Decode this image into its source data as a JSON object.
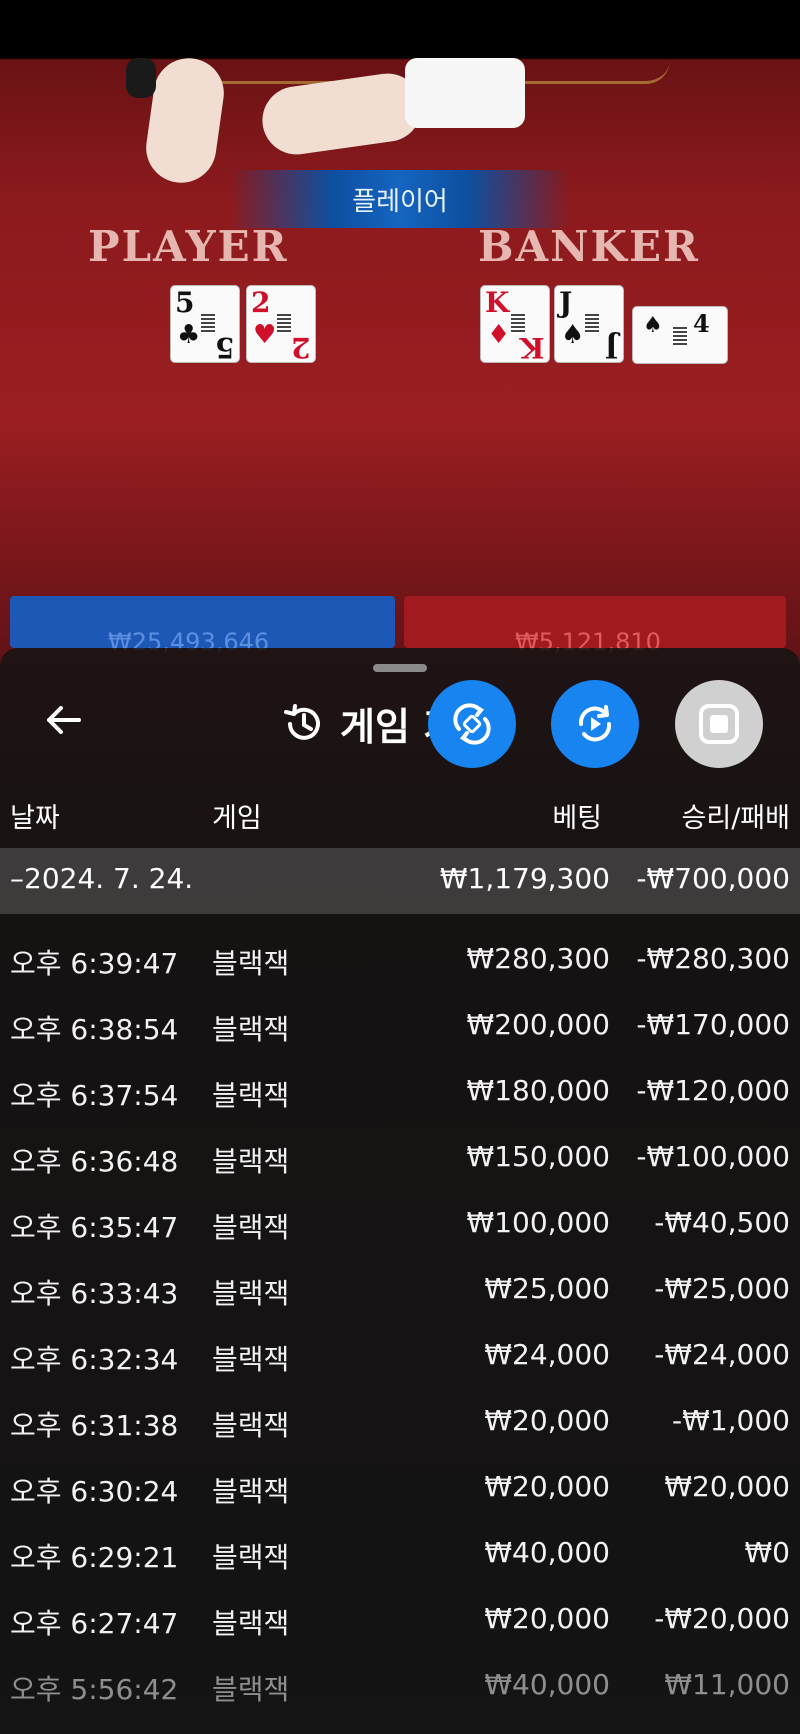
{
  "game_view": {
    "result_banner": "플레이어",
    "player_label": "PLAYER",
    "banker_label": "BANKER",
    "player_cards": [
      {
        "rank": "5",
        "suit": "♣",
        "color": "black"
      },
      {
        "rank": "2",
        "suit": "♥",
        "color": "red"
      }
    ],
    "banker_cards": [
      {
        "rank": "K",
        "suit": "♦",
        "color": "red"
      },
      {
        "rank": "J",
        "suit": "♠",
        "color": "black"
      }
    ],
    "banker_side_card": {
      "rank": "4",
      "suit": "♠",
      "color": "black"
    },
    "player_total_bet": "₩25,493,646",
    "banker_total_bet": "₩5,121,810"
  },
  "history_sheet": {
    "title": "게임 기록",
    "back_icon": "arrow-left-icon",
    "title_icon": "history-icon",
    "columns": {
      "date": "날짜",
      "game": "게임",
      "bet": "베팅",
      "result": "승리/패배"
    },
    "date_group": {
      "label": "–2024. 7. 24.",
      "bet_total": "₩1,179,300",
      "result_total": "-₩700,000"
    },
    "rows": [
      {
        "time": "오후 6:39:47",
        "game": "블랙잭",
        "bet": "₩280,300",
        "result": "-₩280,300"
      },
      {
        "time": "오후 6:38:54",
        "game": "블랙잭",
        "bet": "₩200,000",
        "result": "-₩170,000"
      },
      {
        "time": "오후 6:37:54",
        "game": "블랙잭",
        "bet": "₩180,000",
        "result": "-₩120,000"
      },
      {
        "time": "오후 6:36:48",
        "game": "블랙잭",
        "bet": "₩150,000",
        "result": "-₩100,000"
      },
      {
        "time": "오후 6:35:47",
        "game": "블랙잭",
        "bet": "₩100,000",
        "result": "-₩40,500"
      },
      {
        "time": "오후 6:33:43",
        "game": "블랙잭",
        "bet": "₩25,000",
        "result": "-₩25,000"
      },
      {
        "time": "오후 6:32:34",
        "game": "블랙잭",
        "bet": "₩24,000",
        "result": "-₩24,000"
      },
      {
        "time": "오후 6:31:38",
        "game": "블랙잭",
        "bet": "₩20,000",
        "result": "-₩1,000"
      },
      {
        "time": "오후 6:30:24",
        "game": "블랙잭",
        "bet": "₩20,000",
        "result": "₩20,000"
      },
      {
        "time": "오후 6:29:21",
        "game": "블랙잭",
        "bet": "₩40,000",
        "result": "₩0"
      },
      {
        "time": "오후 6:27:47",
        "game": "블랙잭",
        "bet": "₩20,000",
        "result": "-₩20,000"
      },
      {
        "time": "오후 5:56:42",
        "game": "블랙잭",
        "bet": "₩40,000",
        "result": "₩11,000"
      }
    ]
  },
  "floating_buttons": [
    {
      "name": "rotate-icon",
      "color": "#1784ef"
    },
    {
      "name": "replay-icon",
      "color": "#1784ef"
    },
    {
      "name": "stop-icon",
      "color": "#d0d0d0"
    }
  ]
}
